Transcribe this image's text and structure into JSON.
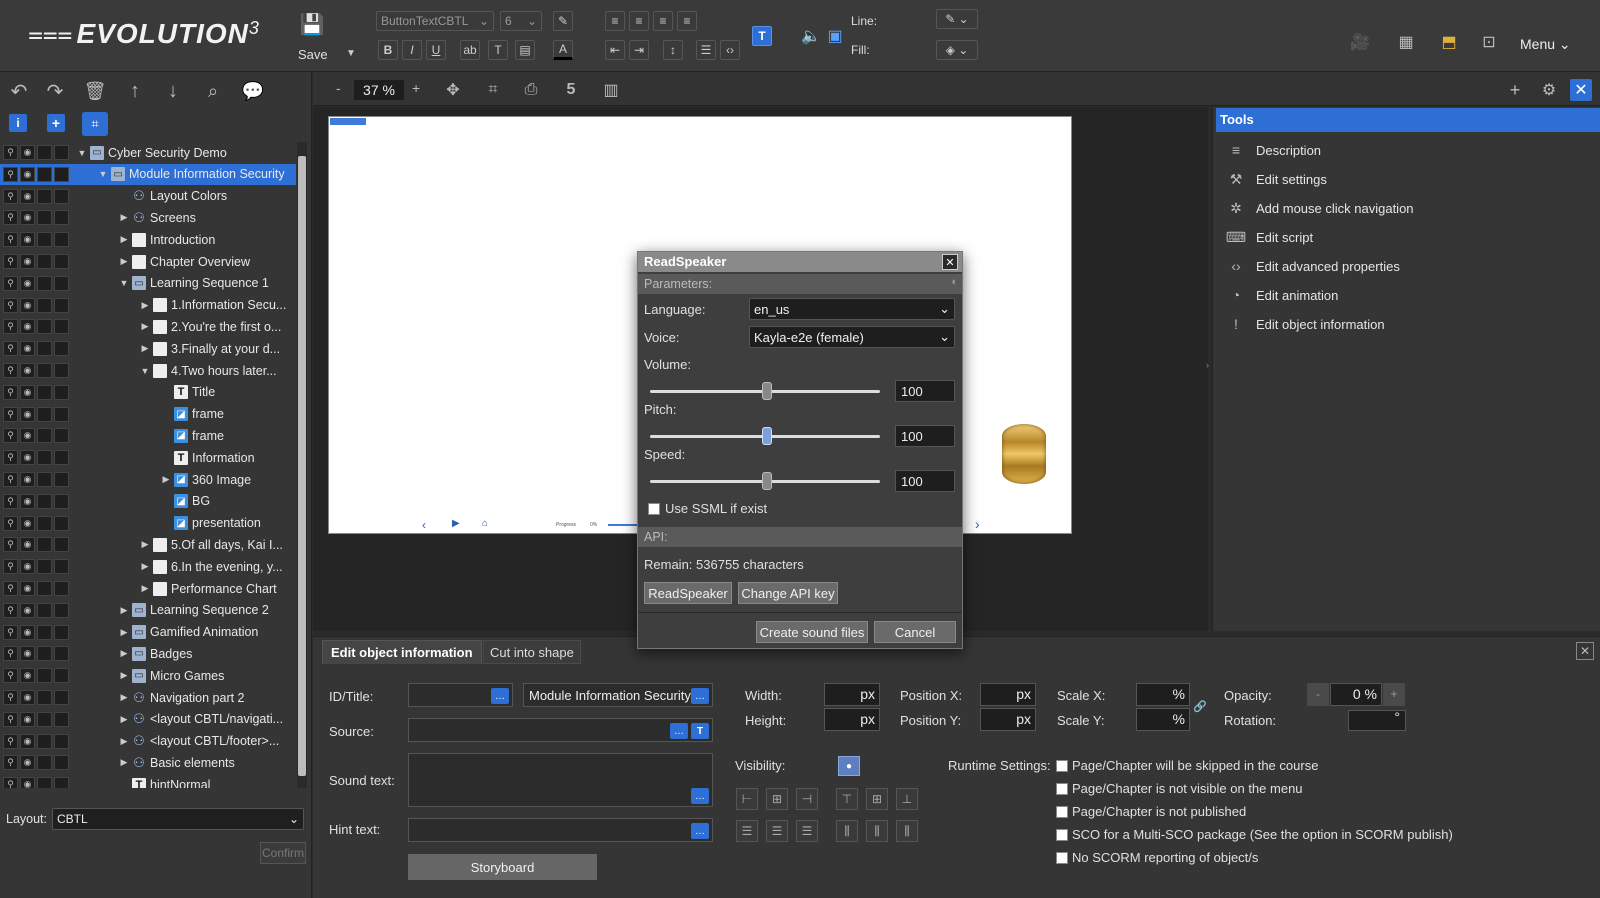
{
  "app": {
    "logo": "EVOLUTION",
    "logo_sup": "3",
    "menu_label": "Menu"
  },
  "toolbar": {
    "save_label": "Save",
    "font_select": "ButtonTextCBTL",
    "size_select": "6",
    "line_label": "Line:",
    "fill_label": "Fill:",
    "zoom_minus": "-",
    "zoom_value": "37 %",
    "zoom_plus": "+"
  },
  "tree": {
    "items": [
      {
        "label": "Cyber Security Demo",
        "level": 0,
        "tri": "▼",
        "icon": "folder",
        "selected": false
      },
      {
        "label": "Module Information Security",
        "level": 1,
        "tri": "▼",
        "icon": "folder",
        "selected": true
      },
      {
        "label": "Layout Colors",
        "level": 2,
        "tri": "",
        "icon": "group",
        "selected": false
      },
      {
        "label": "Screens",
        "level": 2,
        "tri": "▶",
        "icon": "group",
        "selected": false
      },
      {
        "label": "Introduction",
        "level": 2,
        "tri": "▶",
        "icon": "page",
        "selected": false
      },
      {
        "label": "Chapter Overview",
        "level": 2,
        "tri": "▶",
        "icon": "page",
        "selected": false
      },
      {
        "label": "Learning Sequence 1",
        "level": 2,
        "tri": "▼",
        "icon": "folder",
        "selected": false
      },
      {
        "label": "1.Information Secu...",
        "level": 3,
        "tri": "▶",
        "icon": "page",
        "selected": false
      },
      {
        "label": "2.You're the first o...",
        "level": 3,
        "tri": "▶",
        "icon": "page",
        "selected": false
      },
      {
        "label": "3.Finally at your d...",
        "level": 3,
        "tri": "▶",
        "icon": "page",
        "selected": false
      },
      {
        "label": "4.Two hours later...",
        "level": 3,
        "tri": "▼",
        "icon": "page",
        "selected": false
      },
      {
        "label": "Title",
        "level": 4,
        "tri": "",
        "icon": "text",
        "selected": false
      },
      {
        "label": "frame",
        "level": 4,
        "tri": "",
        "icon": "img",
        "selected": false
      },
      {
        "label": "frame",
        "level": 4,
        "tri": "",
        "icon": "img",
        "selected": false
      },
      {
        "label": "Information",
        "level": 4,
        "tri": "",
        "icon": "text",
        "selected": false
      },
      {
        "label": "360 Image",
        "level": 4,
        "tri": "▶",
        "icon": "img",
        "selected": false
      },
      {
        "label": "BG",
        "level": 4,
        "tri": "",
        "icon": "img",
        "selected": false
      },
      {
        "label": "presentation",
        "level": 4,
        "tri": "",
        "icon": "img",
        "selected": false
      },
      {
        "label": "5.Of all days, Kai I...",
        "level": 3,
        "tri": "▶",
        "icon": "page",
        "selected": false
      },
      {
        "label": "6.In the evening, y...",
        "level": 3,
        "tri": "▶",
        "icon": "page",
        "selected": false
      },
      {
        "label": "Performance Chart",
        "level": 3,
        "tri": "▶",
        "icon": "page",
        "selected": false
      },
      {
        "label": "Learning Sequence 2",
        "level": 2,
        "tri": "▶",
        "icon": "folder",
        "selected": false
      },
      {
        "label": "Gamified Animation",
        "level": 2,
        "tri": "▶",
        "icon": "folder",
        "selected": false
      },
      {
        "label": "Badges",
        "level": 2,
        "tri": "▶",
        "icon": "folder",
        "selected": false
      },
      {
        "label": "Micro Games",
        "level": 2,
        "tri": "▶",
        "icon": "folder",
        "selected": false
      },
      {
        "label": "Navigation part 2",
        "level": 2,
        "tri": "▶",
        "icon": "group",
        "selected": false
      },
      {
        "label": "<layout CBTL/navigati...",
        "level": 2,
        "tri": "▶",
        "icon": "group",
        "selected": false
      },
      {
        "label": "<layout CBTL/footer>...",
        "level": 2,
        "tri": "▶",
        "icon": "group",
        "selected": false
      },
      {
        "label": "Basic elements",
        "level": 2,
        "tri": "▶",
        "icon": "group",
        "selected": false
      },
      {
        "label": "hintNormal",
        "level": 2,
        "tri": "",
        "icon": "text",
        "selected": false
      }
    ]
  },
  "layout": {
    "label": "Layout:",
    "value": "CBTL",
    "confirm": "Confirm"
  },
  "tools": {
    "header": "Tools",
    "items": [
      {
        "label": "Description",
        "icon": "≡"
      },
      {
        "label": "Edit settings",
        "icon": "⚒"
      },
      {
        "label": "Add mouse click navigation",
        "icon": "✲"
      },
      {
        "label": "Edit script",
        "icon": "⌨"
      },
      {
        "label": "Edit advanced properties",
        "icon": "‹›"
      },
      {
        "label": "Edit animation",
        "icon": "◔"
      },
      {
        "label": "Edit object information",
        "icon": "!"
      }
    ]
  },
  "dialog": {
    "title": "ReadSpeaker",
    "parameters": "Parameters:",
    "language_label": "Language:",
    "language_value": "en_us",
    "voice_label": "Voice:",
    "voice_value": "Kayla-e2e (female)",
    "volume_label": "Volume:",
    "volume_value": "100",
    "pitch_label": "Pitch:",
    "pitch_value": "100",
    "speed_label": "Speed:",
    "speed_value": "100",
    "ssml_label": "Use SSML if exist",
    "api_label": "API:",
    "remain": "Remain: 536755 characters",
    "readspeaker_btn": "ReadSpeaker",
    "change_api_btn": "Change API key",
    "create_btn": "Create sound files",
    "cancel_btn": "Cancel"
  },
  "canvas": {
    "progress_label": "Progress",
    "progress_value": "0%"
  },
  "bottom": {
    "tab_active": "Edit object information",
    "tab_other": "Cut into shape",
    "id_label": "ID/Title:",
    "title_value": "Module Information Security",
    "source_label": "Source:",
    "sound_label": "Sound text:",
    "hint_label": "Hint text:",
    "storyboard": "Storyboard",
    "width_label": "Width:",
    "height_label": "Height:",
    "posx_label": "Position X:",
    "posy_label": "Position Y:",
    "scalex_label": "Scale X:",
    "scaley_label": "Scale Y:",
    "opacity_label": "Opacity:",
    "opacity_value": "0 %",
    "rotation_label": "Rotation:",
    "px": "px",
    "pct": "%",
    "deg": "°",
    "visibility_label": "Visibility:",
    "runtime_label": "Runtime Settings:",
    "runtime_options": [
      "Page/Chapter will be skipped in the course",
      "Page/Chapter is not visible on the menu",
      "Page/Chapter is not published",
      "SCO for a Multi-SCO package (See the option in SCORM publish)",
      "No SCORM reporting of object/s"
    ]
  }
}
